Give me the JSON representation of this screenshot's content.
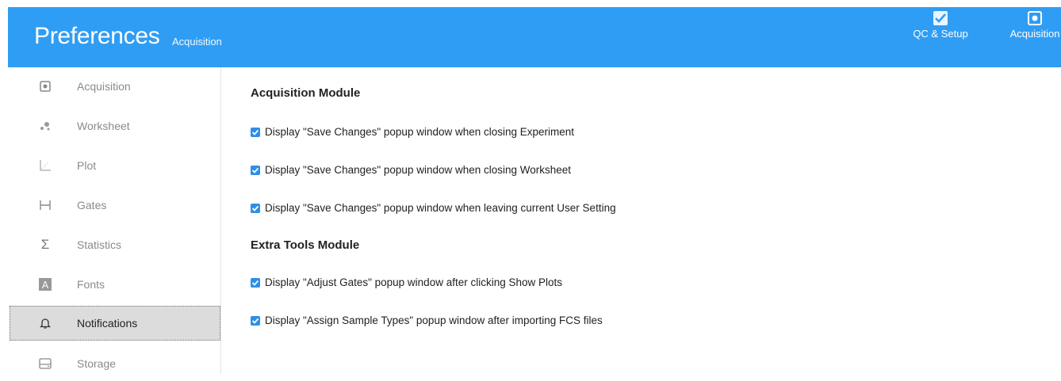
{
  "header": {
    "title": "Preferences",
    "subtitle": "Acquisition",
    "buttons": [
      {
        "label": "QC & Setup",
        "icon": "qc-setup-icon"
      },
      {
        "label": "Acquisition",
        "icon": "acquisition-icon"
      }
    ]
  },
  "sidebar": {
    "items": [
      {
        "label": "Acquisition",
        "icon": "acquisition-icon"
      },
      {
        "label": "Worksheet",
        "icon": "worksheet-icon"
      },
      {
        "label": "Plot",
        "icon": "plot-icon"
      },
      {
        "label": "Gates",
        "icon": "gates-icon"
      },
      {
        "label": "Statistics",
        "icon": "sigma-icon"
      },
      {
        "label": "Fonts",
        "icon": "font-icon"
      },
      {
        "label": "Notifications",
        "icon": "bell-icon",
        "active": true
      },
      {
        "label": "Storage",
        "icon": "storage-icon"
      }
    ]
  },
  "main": {
    "sections": [
      {
        "title": "Acquisition Module",
        "options": [
          {
            "label": "Display \"Save Changes\" popup window when closing Experiment",
            "checked": true
          },
          {
            "label": "Display \"Save Changes\" popup window when closing Worksheet",
            "checked": true
          },
          {
            "label": "Display \"Save Changes\" popup window when leaving current User Setting",
            "checked": true
          }
        ]
      },
      {
        "title": "Extra Tools Module",
        "options": [
          {
            "label": "Display \"Adjust Gates\" popup window after clicking Show Plots",
            "checked": true
          },
          {
            "label": "Display \"Assign Sample Types\" popup window after importing FCS files",
            "checked": true
          }
        ]
      }
    ]
  },
  "colors": {
    "header_bg": "#2f9df4",
    "checkbox": "#2f8fe6",
    "active_bg": "#dcdcdc"
  }
}
